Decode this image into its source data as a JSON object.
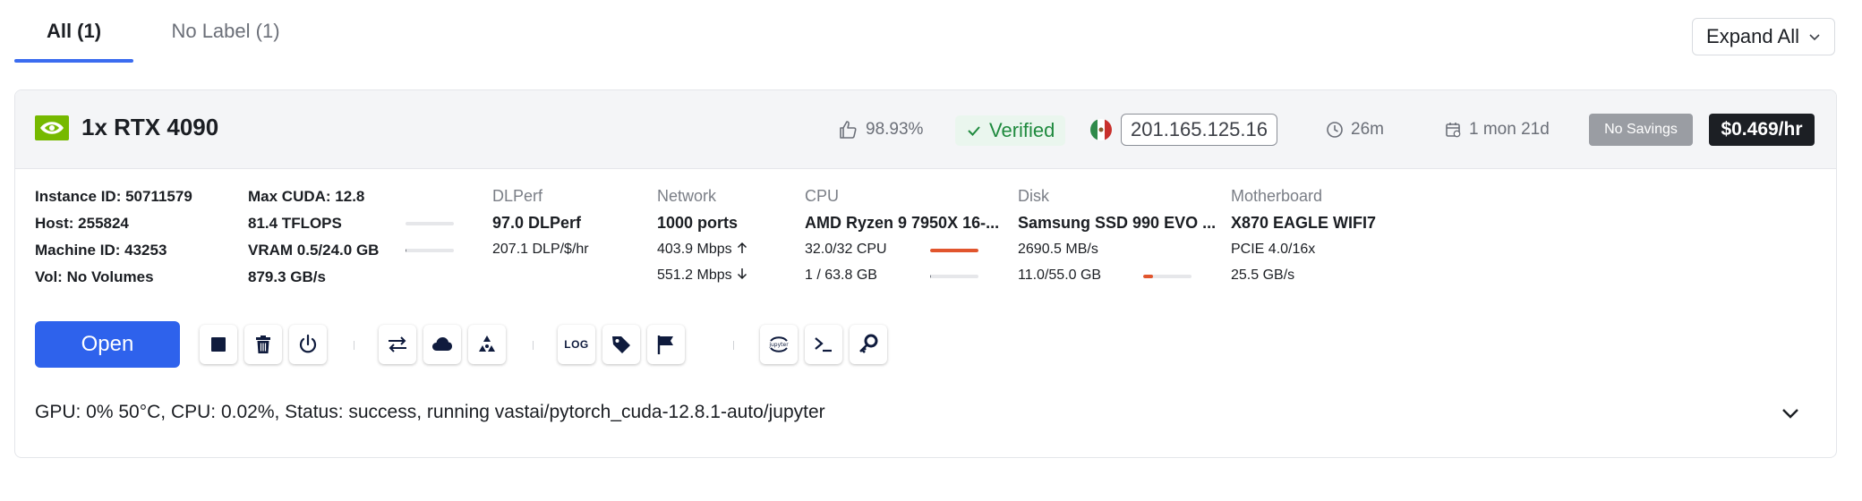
{
  "tabs": [
    {
      "label": "All (1)",
      "active": true
    },
    {
      "label": "No Label (1)",
      "active": false
    }
  ],
  "toolbar": {
    "expand_all": "Expand All"
  },
  "instance": {
    "gpu_title": "1x RTX 4090",
    "rating": "98.93%",
    "verified": "Verified",
    "flag_icon": "mexico-flag-icon",
    "ip": "201.165.125.16",
    "age": "26m",
    "duration": "1 mon 21d",
    "savings": "No Savings",
    "price": "$0.469/hr"
  },
  "stats": {
    "instance_id": "Instance ID: 50711579",
    "host": "Host: 255824",
    "machine_id": "Machine ID: 43253",
    "vol": "Vol: No Volumes",
    "max_cuda": "Max CUDA: 12.8",
    "tflops": "81.4 TFLOPS",
    "tflops_fill": 0,
    "vram": "VRAM 0.5/24.0 GB",
    "vram_fill": 0.02,
    "bandwidth": "879.3 GB/s",
    "dlperf_label": "DLPerf",
    "dlperf": "97.0 DLPerf",
    "dlp_per_dollar": "207.1 DLP/$/hr",
    "network_label": "Network",
    "ports": "1000 ports",
    "upload": "403.9 Mbps",
    "download": "551.2 Mbps",
    "cpu_label": "CPU",
    "cpu_name": "AMD Ryzen 9 7950X 16-...",
    "cpu_cores": "32.0/32 CPU",
    "cpu_fill": 1.0,
    "cpu_ram": "1 / 63.8 GB",
    "cpu_ram_fill": 0.02,
    "disk_label": "Disk",
    "disk_name": "Samsung SSD 990 EVO ...",
    "disk_speed": "2690.5 MB/s",
    "disk_usage": "11.0/55.0 GB",
    "disk_fill": 0.2,
    "mobo_label": "Motherboard",
    "mobo_name": "X870 EAGLE WIFI7",
    "pcie": "PCIE 4.0/16x",
    "pcie_bw": "25.5 GB/s"
  },
  "actions": {
    "open": "Open",
    "log": "LOG",
    "jupyter": "jupyter"
  },
  "status_text": "GPU: 0% 50°C, CPU: 0.02%, Status: success, running vastai/pytorch_cuda-12.8.1-auto/jupyter",
  "colors": {
    "accent": "#2e62ec",
    "verified": "#1f8a3e",
    "bar_fill": "#e1552d"
  }
}
